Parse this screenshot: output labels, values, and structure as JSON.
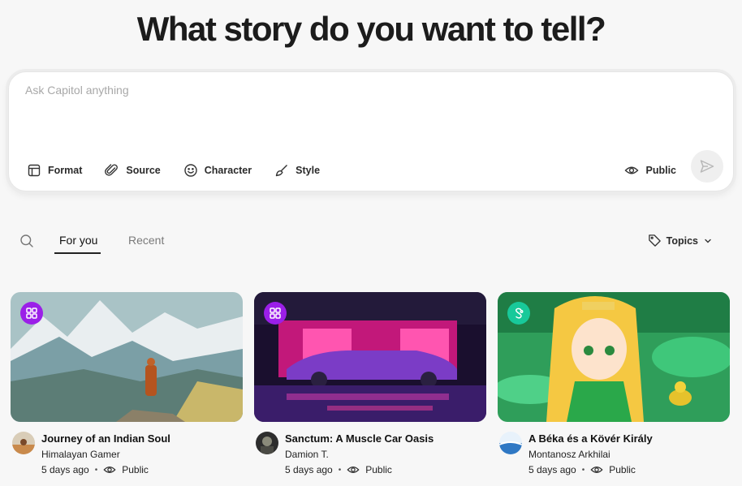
{
  "hero": {
    "title": "What story do you want to tell?"
  },
  "prompt": {
    "placeholder": "Ask Capitol anything",
    "tools": [
      {
        "label": "Format",
        "icon": "layout-icon"
      },
      {
        "label": "Source",
        "icon": "paperclip-icon"
      },
      {
        "label": "Character",
        "icon": "smiley-icon"
      },
      {
        "label": "Style",
        "icon": "brush-icon"
      }
    ],
    "visibility_label": "Public",
    "send_icon": "send-icon"
  },
  "feed": {
    "tabs": [
      {
        "label": "For you",
        "active": true
      },
      {
        "label": "Recent",
        "active": false
      }
    ],
    "topics_label": "Topics"
  },
  "cards": [
    {
      "title": "Journey of an Indian Soul",
      "author": "Himalayan Gamer",
      "age": "5 days ago",
      "visibility": "Public",
      "badge_icon": "grid-icon",
      "badge_color": "#9b1fe8"
    },
    {
      "title": "Sanctum: A Muscle Car Oasis",
      "author": "Damion T.",
      "age": "5 days ago",
      "visibility": "Public",
      "badge_icon": "grid-icon",
      "badge_color": "#9b1fe8"
    },
    {
      "title": "A Béka és a Kövér Király",
      "author": "Montanosz Arkhilai",
      "age": "5 days ago",
      "visibility": "Public",
      "badge_icon": "story-icon",
      "badge_color": "#18c99a"
    }
  ],
  "colors": {
    "accent_purple": "#9b1fe8",
    "accent_teal": "#18c99a",
    "background": "#f7f7f7"
  }
}
